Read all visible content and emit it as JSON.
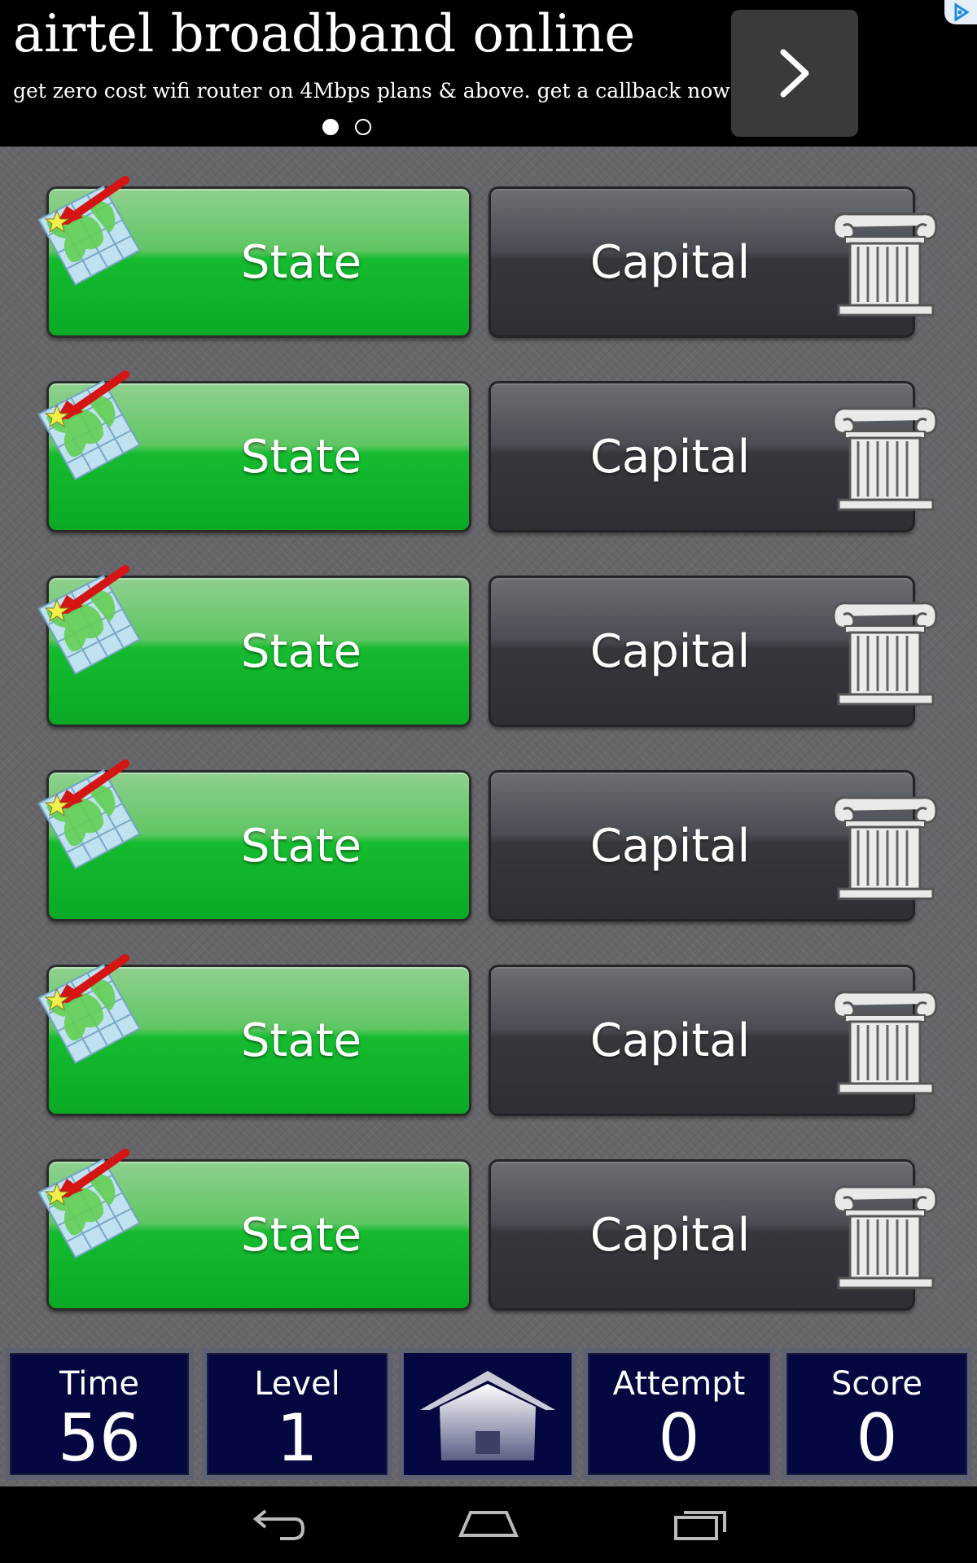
{
  "ad": {
    "title": "airtel broadband online",
    "subtitle": "get zero cost wifi router on 4Mbps plans & above. get a callback now!",
    "dots": [
      {
        "active": true
      },
      {
        "active": false
      }
    ],
    "arrow_icon": "chevron-right-icon",
    "choices_icon": "adchoices-icon"
  },
  "rows": [
    {
      "state_label": "State",
      "capital_label": "Capital"
    },
    {
      "state_label": "State",
      "capital_label": "Capital"
    },
    {
      "state_label": "State",
      "capital_label": "Capital"
    },
    {
      "state_label": "State",
      "capital_label": "Capital"
    },
    {
      "state_label": "State",
      "capital_label": "Capital"
    },
    {
      "state_label": "State",
      "capital_label": "Capital"
    }
  ],
  "icons": {
    "state": "map-pin-icon",
    "capital": "column-icon"
  },
  "status": {
    "time": {
      "label": "Time",
      "value": "56"
    },
    "level": {
      "label": "Level",
      "value": "1"
    },
    "home_icon": "home-icon",
    "attempt": {
      "label": "Attempt",
      "value": "0"
    },
    "score": {
      "label": "Score",
      "value": "0"
    }
  },
  "navbar": {
    "back_icon": "back-icon",
    "home_icon": "home-outline-icon",
    "recents_icon": "recents-icon"
  },
  "colors": {
    "state_green": "#0aaa25",
    "capital_gray": "#35373c",
    "status_navy": "#050840"
  }
}
